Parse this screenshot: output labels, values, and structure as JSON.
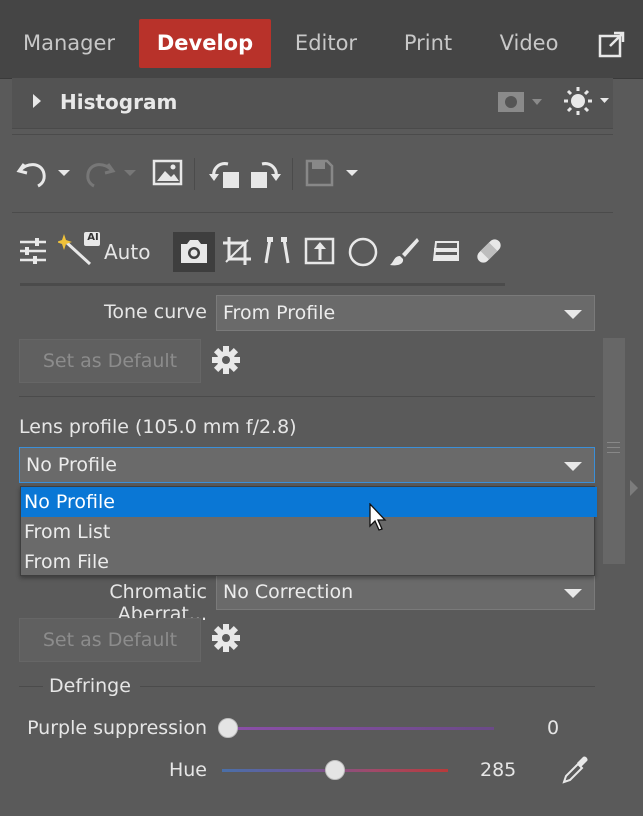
{
  "tabs": [
    {
      "label": "Manager",
      "active": false
    },
    {
      "label": "Develop",
      "active": true
    },
    {
      "label": "Editor",
      "active": false
    },
    {
      "label": "Print",
      "active": false
    },
    {
      "label": "Video",
      "active": false
    }
  ],
  "histogram": {
    "title": "Histogram"
  },
  "tools": {
    "auto_label": "Auto",
    "ai_badge": "AI"
  },
  "tone_curve": {
    "label": "Tone curve",
    "value": "From Profile"
  },
  "set_default_label": "Set as Default",
  "lens_profile": {
    "label": "Lens profile (105.0 mm f/2.8)",
    "value": "No Profile",
    "options": [
      "No Profile",
      "From List",
      "From File"
    ],
    "selected": "No Profile"
  },
  "chromatic": {
    "label": "Chromatic Aberrat...",
    "value": "No Correction"
  },
  "defringe": {
    "title": "Defringe",
    "purple": {
      "label": "Purple suppression",
      "value": "0",
      "fraction": 0.0
    },
    "hue": {
      "label": "Hue",
      "value": "285",
      "fraction": 0.5
    }
  },
  "colors": {
    "accent": "#b8322a",
    "selection": "#0a77d5"
  }
}
